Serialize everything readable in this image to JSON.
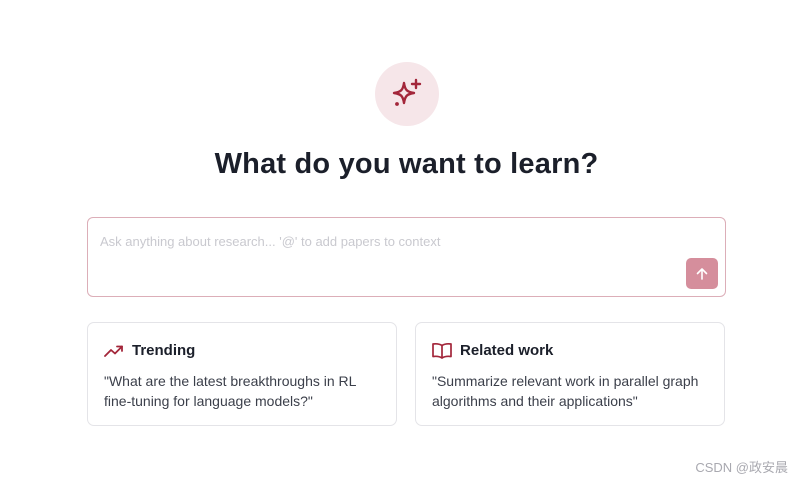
{
  "hero": {
    "icon": "sparkles-icon"
  },
  "title": "What do you want to learn?",
  "search": {
    "placeholder": "Ask anything about research... '@' to add papers to context",
    "value": "",
    "send_icon": "arrow-up-icon"
  },
  "suggestions": [
    {
      "icon": "trending-up-icon",
      "title": "Trending",
      "prompt": "\"What are the latest breakthroughs in RL fine-tuning for language models?\""
    },
    {
      "icon": "open-book-icon",
      "title": "Related work",
      "prompt": "\"Summarize relevant work in parallel graph algorithms and their applications\""
    }
  ],
  "watermark": "CSDN @政安晨",
  "colors": {
    "accent": "#a3263a",
    "accent_soft": "#f6e6e9",
    "send_button": "#d58e9c",
    "input_border": "#dcaeb8"
  }
}
